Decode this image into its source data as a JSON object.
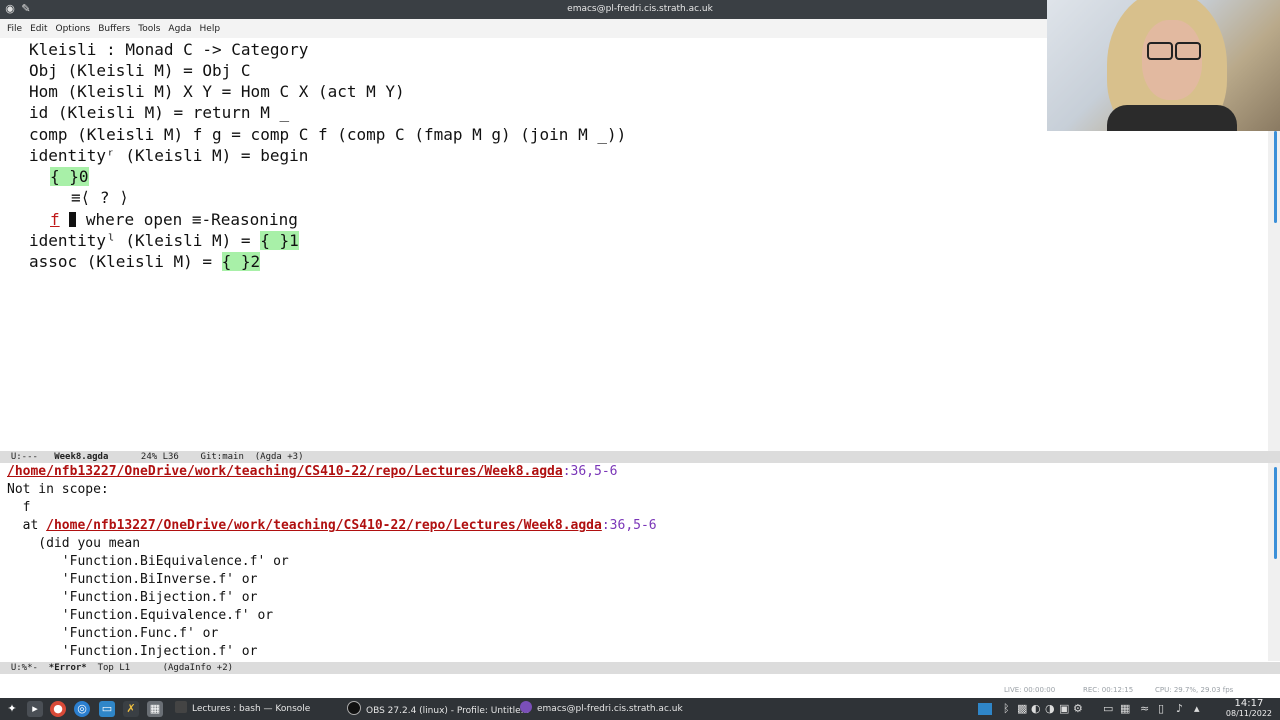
{
  "window": {
    "title": "emacs@pl-fredri.cis.strath.ac.uk"
  },
  "menu": [
    "File",
    "Edit",
    "Options",
    "Buffers",
    "Tools",
    "Agda",
    "Help"
  ],
  "code": {
    "l1": "Kleisli : Monad C -> Category",
    "l2": "Obj (Kleisli M) = Obj C",
    "l3": "Hom (Kleisli M) X Y = Hom C X (act M Y)",
    "l4": "id (Kleisli M) = return M _",
    "l5": "comp (Kleisli M) f g = comp C f (comp C (fmap M g) (join M _))",
    "l6": "identityʳ (Kleisli M) = begin",
    "l7_hole": "{ }0",
    "l8": "≡⟨ ? ⟩",
    "l9_f": "f",
    "l9_rest": " where open ≡-Reasoning",
    "l10_pre": "identityˡ (Kleisli M) = ",
    "l10_hole": "{ }1",
    "l11_pre": "assoc (Kleisli M) = ",
    "l11_hole": "{ }2"
  },
  "modeline_top": {
    "state": "U:---",
    "buffer": "Week8.agda",
    "position": "24% L36",
    "git": "Git:main",
    "mode": "(Agda +3)"
  },
  "info": {
    "path": "/home/nfb13227/OneDrive/work/teaching/CS410-22/repo/Lectures/Week8.agda",
    "pos": ":36,5-6",
    "l2": "Not in scope:",
    "l3": "  f",
    "l4_pre": "  at ",
    "l5": "    (did you mean",
    "l6": "       'Function.BiEquivalence.f' or",
    "l7": "       'Function.BiInverse.f' or",
    "l8": "       'Function.Bijection.f' or",
    "l9": "       'Function.Equivalence.f' or",
    "l10": "       'Function.Func.f' or",
    "l11": "       'Function.Injection.f' or"
  },
  "modeline_bottom": {
    "state": "U:%*-",
    "buffer": "*Error*",
    "position": "Top L1",
    "mode": "(AgdaInfo +2)"
  },
  "obs_status": {
    "live": "LIVE: 00:00:00",
    "rec": "REC: 00:12:15",
    "cpu": "CPU: 29.7%, 29.03 fps"
  },
  "taskbar": {
    "tasks": [
      "Lectures : bash — Konsole",
      "OBS 27.2.4 (linux) - Profile: Untitle...",
      "emacs@pl-fredri.cis.strath.ac.uk"
    ],
    "time": "14:17",
    "date": "08/11/2022"
  },
  "colors": {
    "hole": "#a8f0a8",
    "error_path": "#b01010",
    "position": "#7a36b8",
    "titlebar": "#3a3f44",
    "taskbar": "#2f3337"
  }
}
